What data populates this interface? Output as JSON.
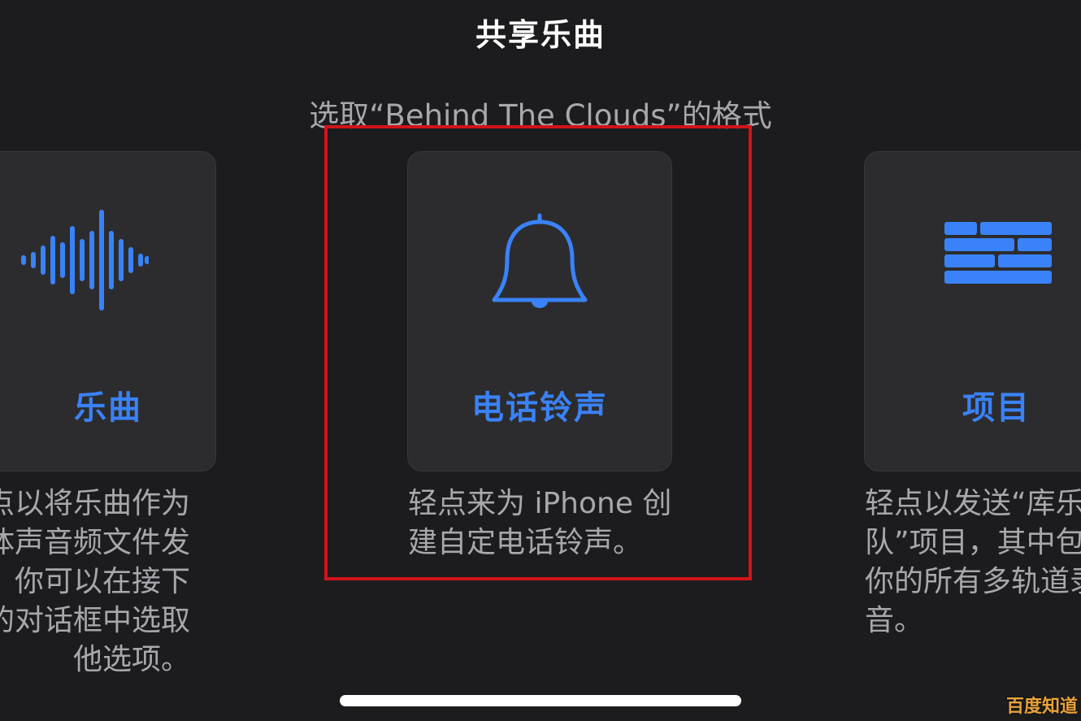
{
  "header": {
    "title": "共享乐曲",
    "subtitle": "选取“Behind The Clouds”的格式"
  },
  "options": [
    {
      "label": "乐曲",
      "icon": "waveform-icon",
      "description_lines": [
        "点以将乐曲作为",
        "体声音频文件发",
        "。你可以在接下",
        "的对话框中选取",
        "他选项。"
      ]
    },
    {
      "label": "电话铃声",
      "icon": "bell-icon",
      "description": "轻点来为 iPhone 创建自定电话铃声。",
      "highlighted": true
    },
    {
      "label": "项目",
      "icon": "bricks-icon",
      "description_lines": [
        "轻点以发送“库乐",
        "队”项目，其中包",
        "你的所有多轨道录",
        "音。"
      ]
    }
  ],
  "watermark": "百度知道",
  "colors": {
    "accent": "#3a82f7",
    "highlight_border": "#d0141a",
    "background": "#1c1c1e"
  }
}
